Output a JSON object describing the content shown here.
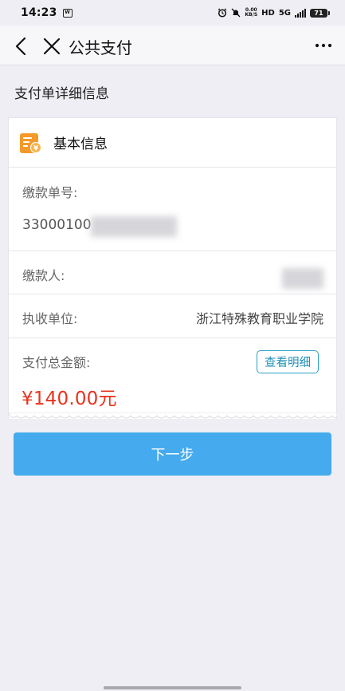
{
  "status_bar": {
    "time": "14:23",
    "app_badge": "W",
    "speed_top": "0.00",
    "speed_bottom": "KB/S",
    "hd_label": "HD",
    "network": "5G",
    "battery": "71"
  },
  "nav": {
    "title": "公共支付",
    "back_icon": "chevron-left-icon",
    "close_icon": "close-icon",
    "more_icon": "more-horizontal-icon"
  },
  "page": {
    "section_heading": "支付单详细信息"
  },
  "card": {
    "header_title": "基本信息",
    "header_icon": "bill-icon",
    "payment_no_label": "缴款单号:",
    "payment_no_value": "33000100",
    "payer_label": "缴款人:",
    "payer_value": "",
    "collector_label": "执收单位:",
    "collector_value": "浙江特殊教育职业学院",
    "total_label": "支付总金额:",
    "detail_button": "查看明细",
    "total_amount": "¥140.00元"
  },
  "actions": {
    "next_button": "下一步"
  },
  "colors": {
    "accent_blue": "#45aaee",
    "amount_red": "#e8331e",
    "icon_orange": "#f59a2a",
    "detail_border": "#2b9fc7"
  }
}
